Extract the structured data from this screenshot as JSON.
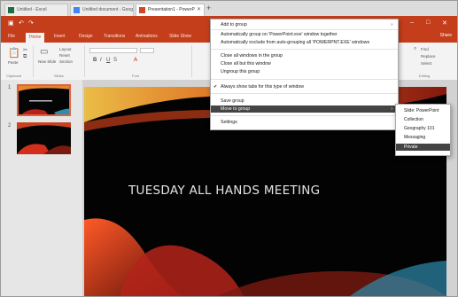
{
  "browser": {
    "tabs": [
      {
        "title": "Untitled - Excel",
        "favicon_color": "#1d6f42"
      },
      {
        "title": "Untitled document - Goog",
        "favicon_color": "#4285f4"
      },
      {
        "title": "Presentation1 - PowerP",
        "favicon_color": "#d24726"
      }
    ],
    "new_tab_symbol": "+"
  },
  "powerpoint": {
    "ribbon_tabs": [
      "File",
      "Home",
      "Insert",
      "Design",
      "Transitions",
      "Animations",
      "Slide Show"
    ],
    "active_tab": "Home",
    "share_label": "Share",
    "ribbon": {
      "paste_label": "Paste",
      "new_slide_label": "New Slide",
      "layout_label": "Layout",
      "reset_label": "Reset",
      "section_label": "Section",
      "font_placeholder": "",
      "find_label": "Find",
      "replace_label": "Replace",
      "select_label": "Select",
      "groups": [
        "Clipboard",
        "Slides",
        "Font",
        "Editing"
      ]
    },
    "slides": [
      {
        "number": "1"
      },
      {
        "number": "2"
      }
    ],
    "slide_title": "TUESDAY ALL HANDS MEETING"
  },
  "context_menu": {
    "items": [
      {
        "label": "Add to group",
        "arrow": "›",
        "highlighted": false
      },
      {
        "label": "Automatically group on 'PowerPoint.exe' window together",
        "highlighted": false
      },
      {
        "label": "Automatically exclude from auto-grouping all 'POWERPNT.EXE' windows",
        "highlighted": false
      },
      {
        "label": "Close all windows in the group",
        "highlighted": false
      },
      {
        "label": "Close all but this window",
        "highlighted": false
      },
      {
        "label": "Ungroup this group",
        "highlighted": false
      },
      {
        "label": "Always show tabs for this type of window",
        "checked": true,
        "highlighted": false
      },
      {
        "label": "Save group",
        "highlighted": false
      },
      {
        "label": "Move to group",
        "arrow": "›",
        "highlighted": true
      },
      {
        "label": "Settings",
        "highlighted": false
      }
    ],
    "submenu": [
      {
        "label": "Slide: PowerPoint",
        "highlighted": false
      },
      {
        "label": "Collection",
        "highlighted": false
      },
      {
        "label": "Geography 101",
        "highlighted": false
      },
      {
        "label": "Messaging",
        "highlighted": false
      },
      {
        "label": "Private",
        "highlighted": true
      }
    ]
  },
  "colors": {
    "accent": "#c43e1c",
    "menu_highlight": "#444444"
  }
}
